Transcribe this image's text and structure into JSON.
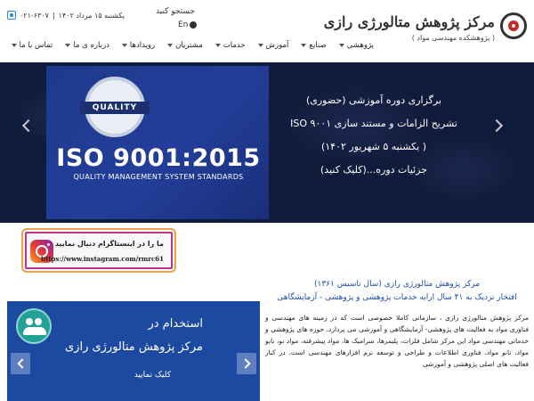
{
  "header": {
    "logo_title": "مرکز پژوهش متالورژی رازی",
    "logo_subtitle": "( پژوهشکده مهندسی مواد )",
    "contact": {
      "date": "یکشنبه ۱۵ مرداد ۱۴۰۲",
      "phone": "۰۲۱-۶۳۰۷"
    },
    "search_label": "جستجو کنید",
    "language_label": "En"
  },
  "nav": {
    "items": [
      {
        "label": "پژوهشی",
        "has_dropdown": true
      },
      {
        "label": "صنایع",
        "has_dropdown": true
      },
      {
        "label": "آموزش",
        "has_dropdown": true
      },
      {
        "label": "خدمات",
        "has_dropdown": true
      },
      {
        "label": "مشتریان",
        "has_dropdown": true
      },
      {
        "label": "رویدادها",
        "has_dropdown": true
      },
      {
        "label": "درباره ی ما",
        "has_dropdown": true
      },
      {
        "label": "تماس با ما",
        "has_dropdown": true
      }
    ]
  },
  "hero": {
    "badge_text": "QUALITY",
    "iso_title": "ISO 9001:2015",
    "iso_subtitle": "QUALITY MANAGEMENT SYSTEM STANDARDS",
    "lines": [
      "برگزاری دوره آموزشی (حضوری)",
      "تشریح الزامات و مستند سازی ISO ۹۰۰۱",
      "( یکشنبه ۵ شهریور ۱۴۰۲)",
      "جزئیات دوره...(کلیک کنید)"
    ]
  },
  "instagram": {
    "title": "ما را در اینستاگرام دنبال نمایید",
    "url": "https://www.instagram.com/rmrc61"
  },
  "job_banner": {
    "line1": "استخدام در",
    "line2": "مرکز پژوهش متالورژی رازی",
    "cta": "کلیک نمایید"
  },
  "about": {
    "title": "مرکز پژوهش متالورژی رازی (سال تاسیس ۱۳۶۱)",
    "subtitle": "افتخار نزدیک به ۴۱ سال ارایه خدمات پژوهشی و پژوهشی - آزمایشگاهی",
    "body": "مرکز پژوهش متالورژی رازی ، سازمانی کاملا خصوصی است که در زمینه های مهندسی و فناوری مواد به فعالیت های پژوهشی- آزمایشگاهی و آموزشی می پردازد. حوزه های پژوهشی و خدماتی مهندسی مواد این مرکز شامل فلزات، پلیمرها، سرامیک ها، مواد پیشرفته، مواد نو، بایو مواد، نانو مواد، فناوری اطلاعات و طراحی و توسعه نرم افزارهای مهندسی است. در کنار فعالیت های اصلی پژوهشی و آموزشی"
  }
}
